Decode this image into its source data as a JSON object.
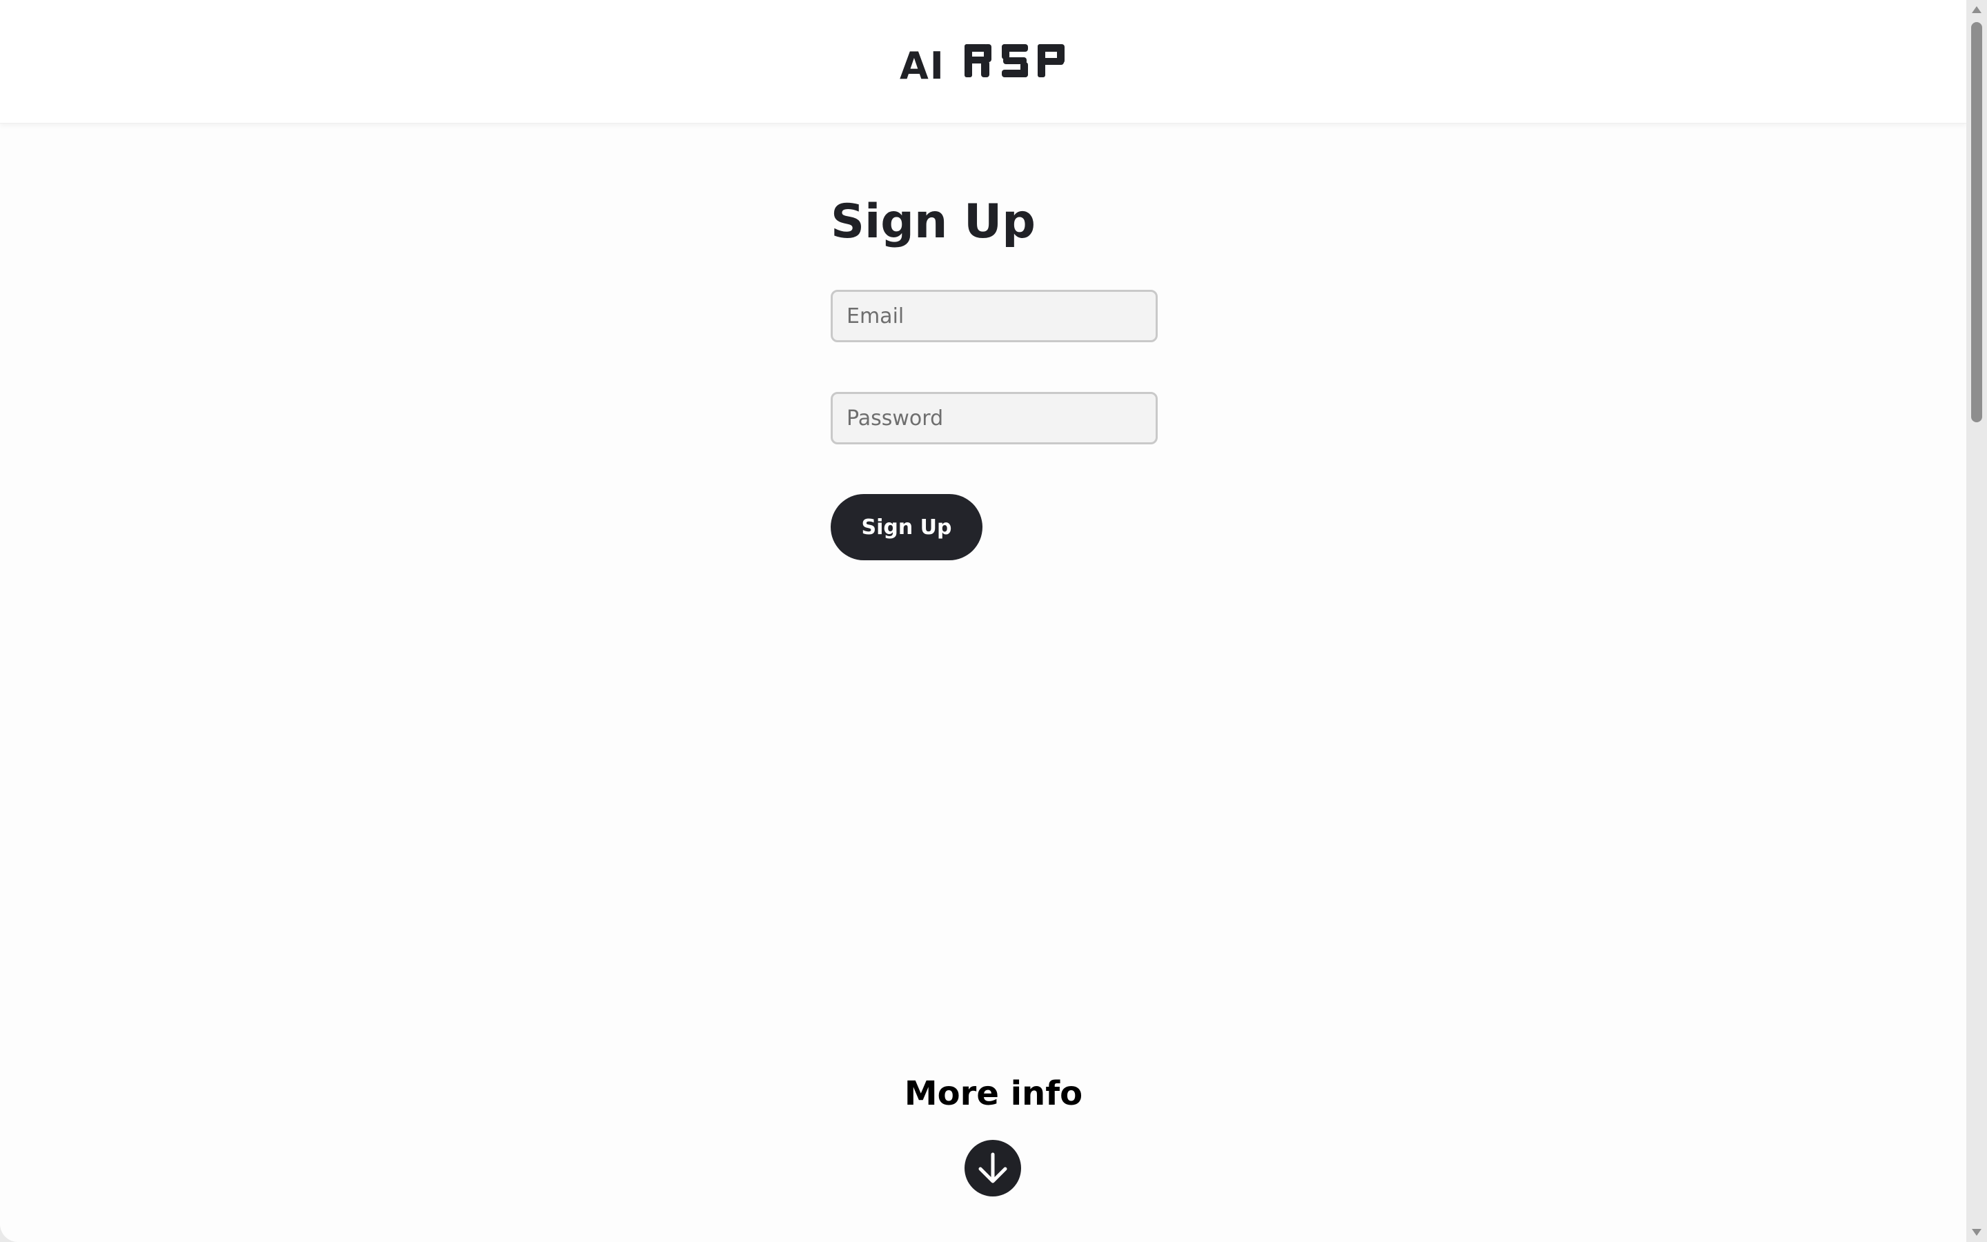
{
  "header": {
    "logo_text": "AI",
    "logo_mark": "RSP"
  },
  "signup": {
    "title": "Sign Up",
    "email_placeholder": "Email",
    "password_placeholder": "Password",
    "button_label": "Sign Up"
  },
  "more_info": {
    "label": "More info",
    "icon": "arrow-down-circle-icon"
  },
  "colors": {
    "primary": "#23242a",
    "text": "#202126",
    "input_bg": "#f3f3f3",
    "input_border": "#c9c9c9"
  }
}
